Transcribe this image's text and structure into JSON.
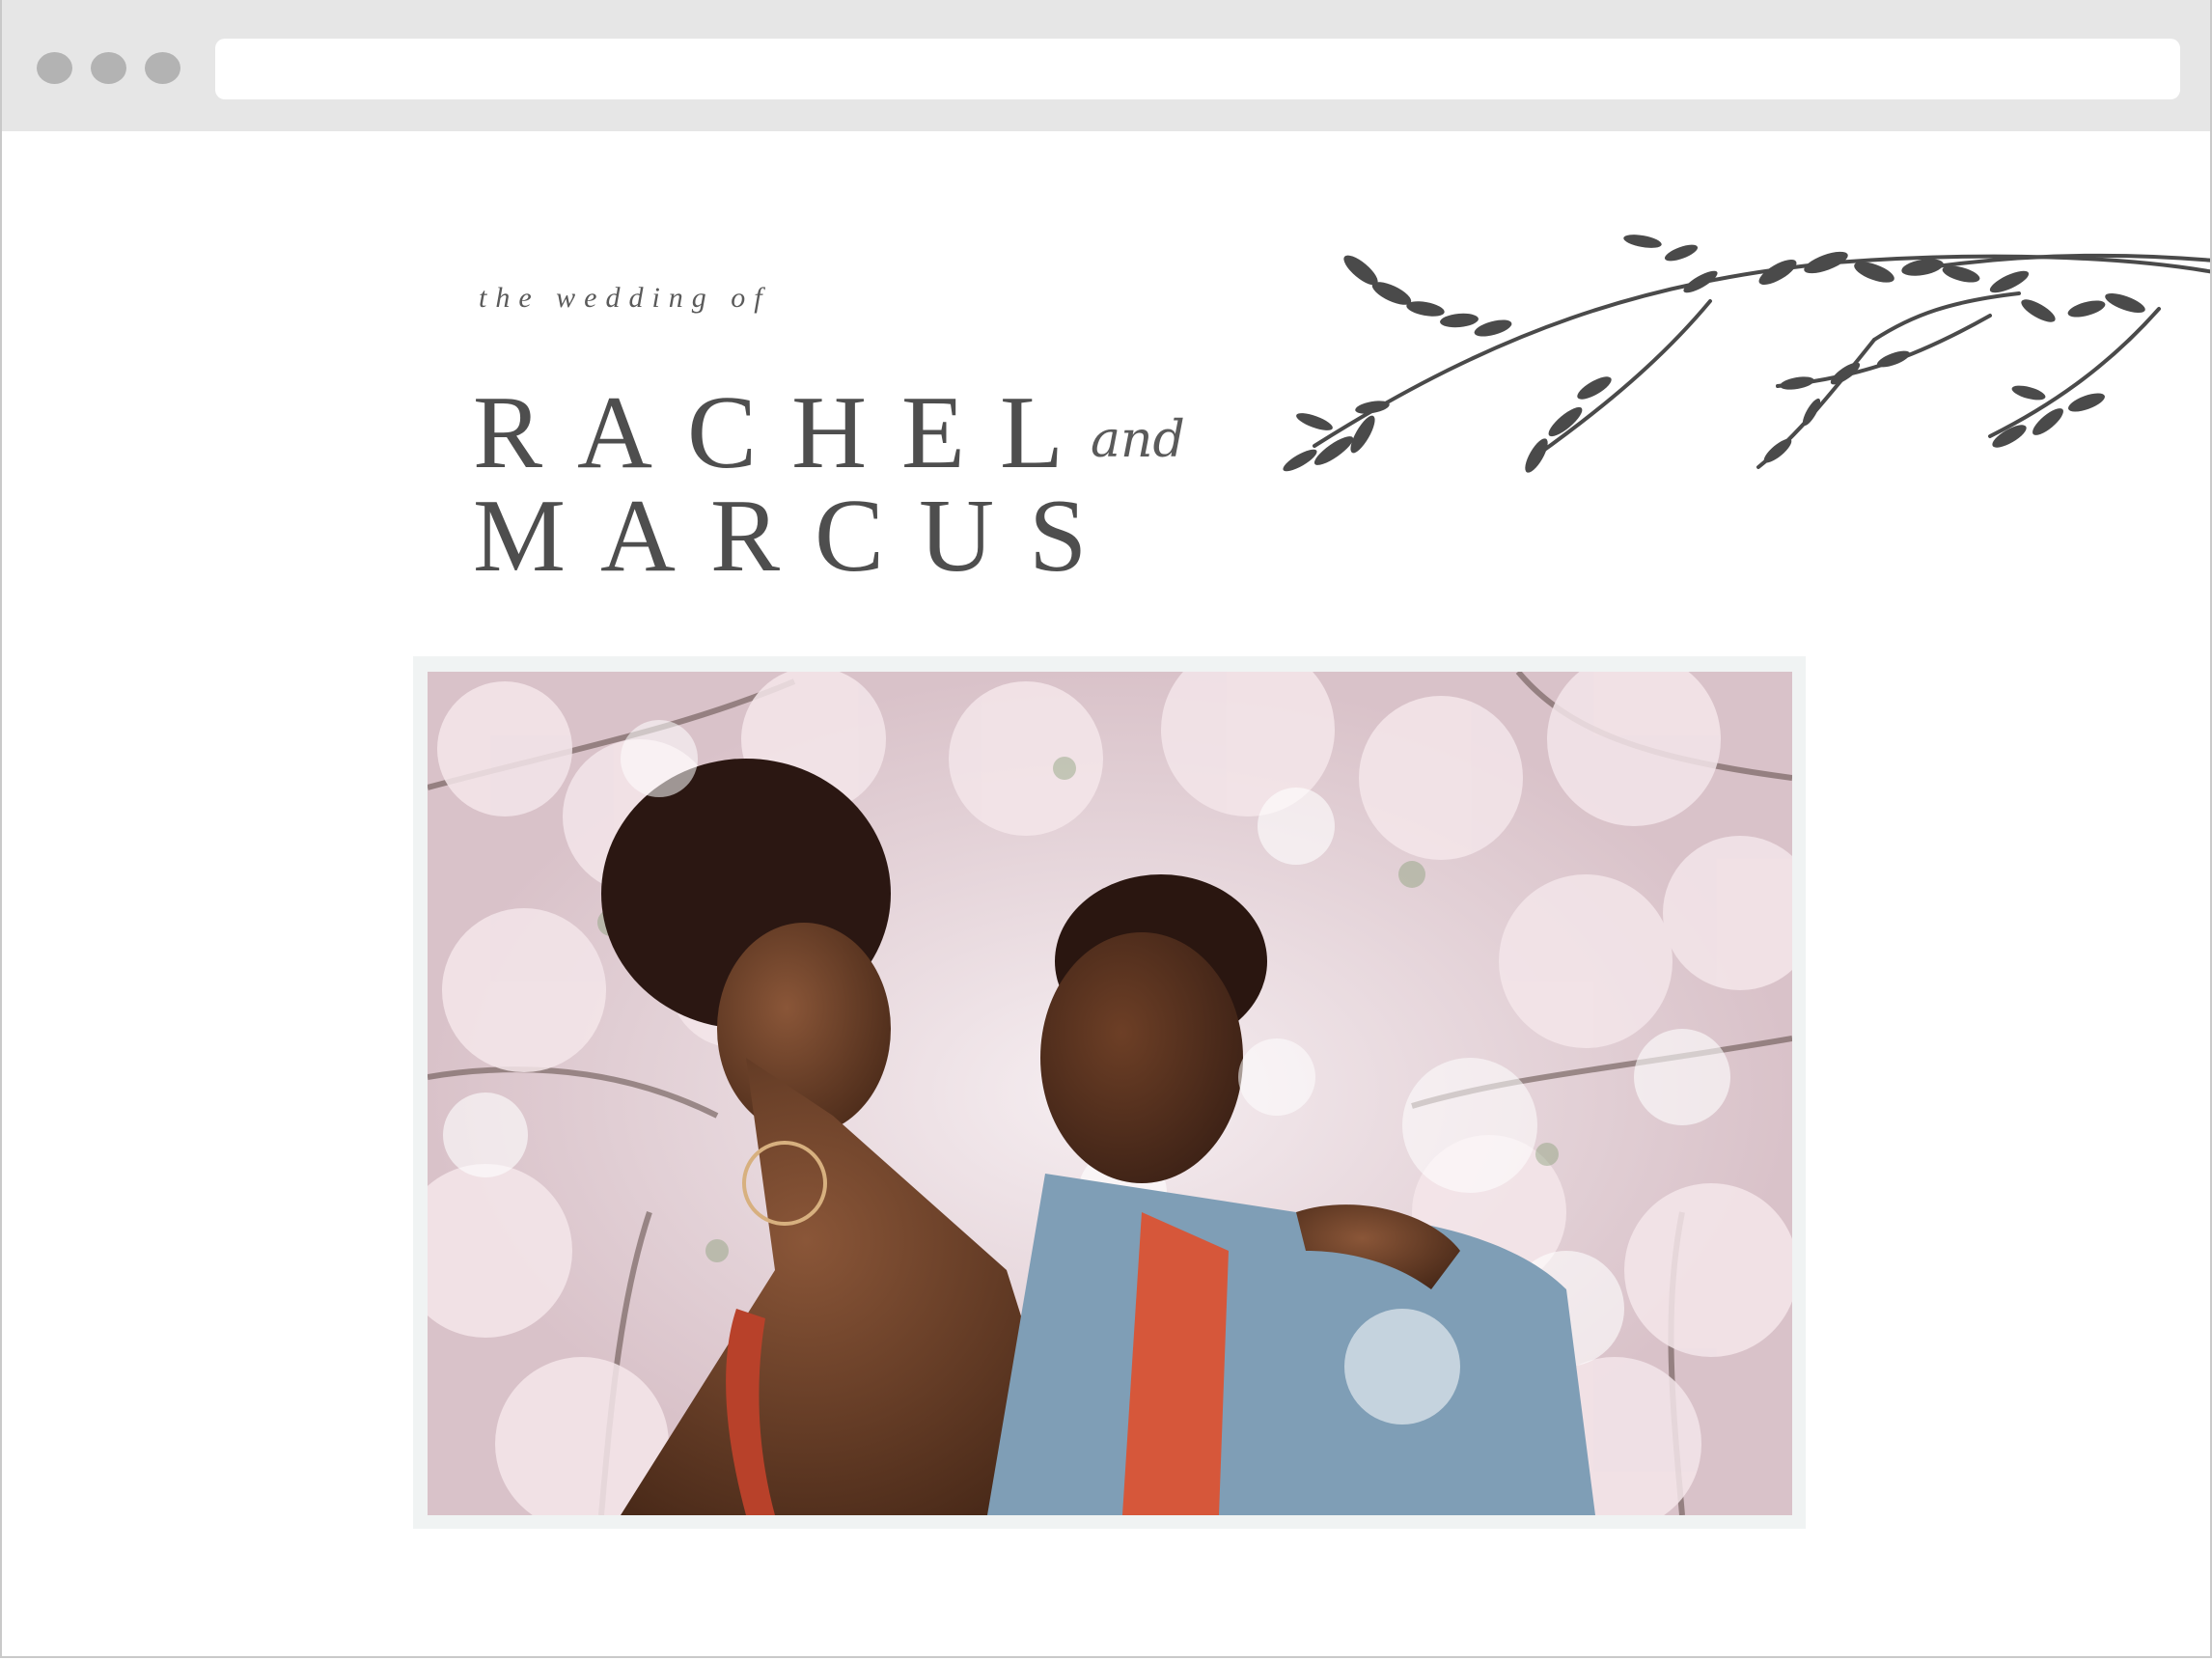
{
  "browser": {
    "window_controls": [
      "close-dot",
      "minimize-dot",
      "maximize-dot"
    ],
    "address_bar_value": ""
  },
  "hero": {
    "kicker": "the wedding of",
    "first_name": "RACHEL",
    "conjunction": "and",
    "second_name": "MARCUS"
  },
  "photo": {
    "subject": "couple-among-cherry-blossoms"
  },
  "colors": {
    "text": "#4e4e4e",
    "chrome": "#e6e6e6",
    "blossom": "#e9d6dc",
    "frame": "#f0f3f3"
  }
}
